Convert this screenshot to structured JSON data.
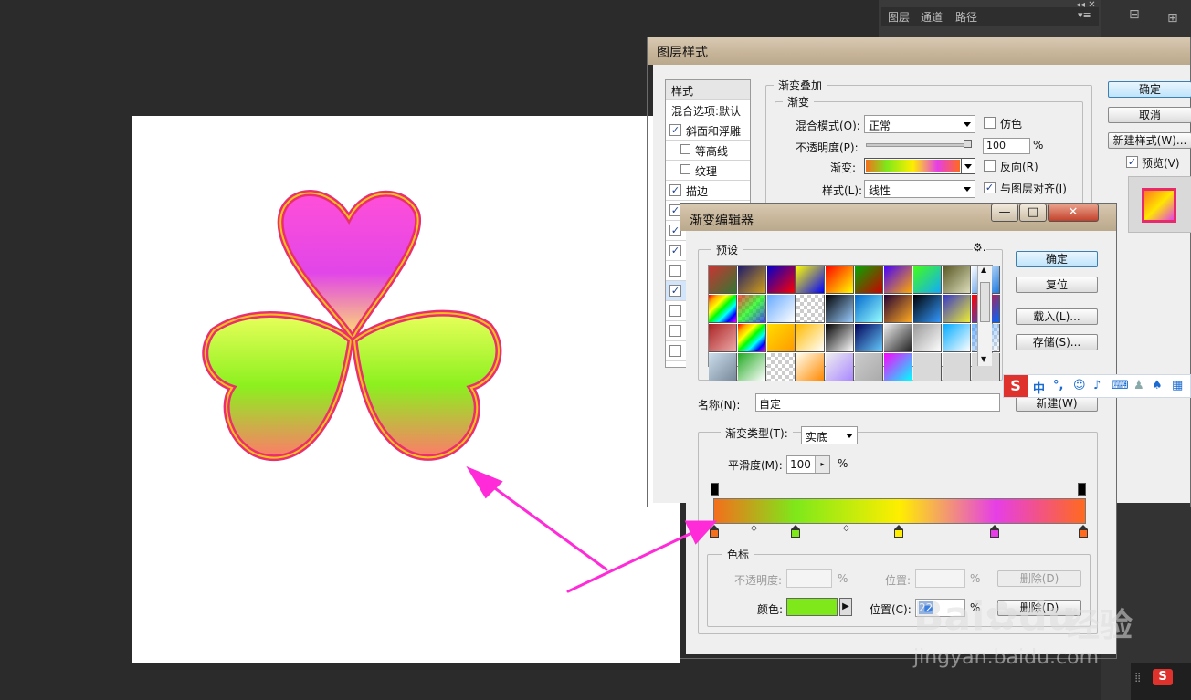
{
  "ps": {
    "tabs": [
      "图层",
      "通道",
      "路径"
    ]
  },
  "layer_style": {
    "title": "图层样式",
    "styles_header": "样式",
    "blend_default": "混合选项:默认",
    "items": [
      {
        "label": "斜面和浮雕",
        "checked": true
      },
      {
        "label": "等高线",
        "checked": false
      },
      {
        "label": "纹理",
        "checked": false
      },
      {
        "label": "描边",
        "checked": true
      }
    ],
    "more_checks": [
      true,
      true,
      true,
      false,
      true,
      false,
      false,
      false
    ],
    "section_title": "渐变叠加",
    "group_title": "渐变",
    "blend_mode_label": "混合模式(O):",
    "blend_mode_value": "正常",
    "dither_label": "仿色",
    "opacity_label": "不透明度(P):",
    "opacity_value": "100",
    "percent": "%",
    "gradient_label": "渐变:",
    "reverse_label": "反向(R)",
    "style_label": "样式(L):",
    "style_value": "线性",
    "align_label": "与图层对齐(I)",
    "ok_label": "确定",
    "cancel_label": "取消",
    "new_style_label": "新建样式(W)...",
    "preview_label": "预览(V)"
  },
  "gradient_editor": {
    "title": "渐变编辑器",
    "minimize_label": "—",
    "maximize_label": "□",
    "close_label": "✕",
    "presets_label": "预设",
    "ok_label": "确定",
    "reset_label": "复位",
    "load_label": "载入(L)...",
    "save_label": "存储(S)...",
    "name_label": "名称(N):",
    "name_value": "自定",
    "new_label": "新建(W)",
    "type_label": "渐变类型(T):",
    "type_value": "实底",
    "smooth_label": "平滑度(M):",
    "smooth_value": "100",
    "percent": "%",
    "stops_group": "色标",
    "opacity_label": "不透明度:",
    "location_label": "位置:",
    "delete_label": "删除(D)",
    "color_label": "颜色:",
    "color_value": "#7ee81a",
    "location_c_label": "位置(C):",
    "location_c_value": "22",
    "gradient_stops": [
      {
        "pos": 0,
        "color": "#f46f1c"
      },
      {
        "pos": 22,
        "color": "#7ee81a"
      },
      {
        "pos": 50,
        "color": "#ffee00"
      },
      {
        "pos": 76,
        "color": "#e63ee7"
      },
      {
        "pos": 100,
        "color": "#ff6a1e"
      }
    ],
    "preset_swatches": [
      [
        "#c33,#373",
        "#1a1a6e,#d4a017",
        "#00c,#f00",
        "#ff0,#00f",
        "#f00,#ff0",
        "#0a0,#c00",
        "#40f,#fa0",
        "#4f1,#1af",
        "#552,#ddb",
        "#fff,#1f7be0"
      ],
      [
        "rainbow",
        "checker-rainbow",
        "#6af,#fff",
        "checker",
        "#000,#9cf",
        "#06c,#9ff",
        "#203,#fa2",
        "#000,#39f",
        "#33c,#ee3",
        "#f00,#06f"
      ],
      [
        "#a22,#eaa",
        "rainbow2",
        "#fd0,#f90",
        "#fb0,#fff",
        "#000,#fff",
        "#005,#6cf",
        "#eee,#222",
        "#999,#fff",
        "#0af,#fff",
        "checker-blue"
      ],
      [
        "#cde,#789",
        "#2a2,#fff",
        "checker",
        "#ffe,#f80",
        "#eee,#a8f",
        "#ccc,#aaa",
        "#f0f,#0ff",
        "",
        "",
        ""
      ]
    ]
  },
  "ime": {
    "label": "中"
  },
  "watermark": {
    "brand": "Bai",
    "brand2": "du",
    "cn": "经验",
    "url": "jingyan.baidu.com"
  }
}
